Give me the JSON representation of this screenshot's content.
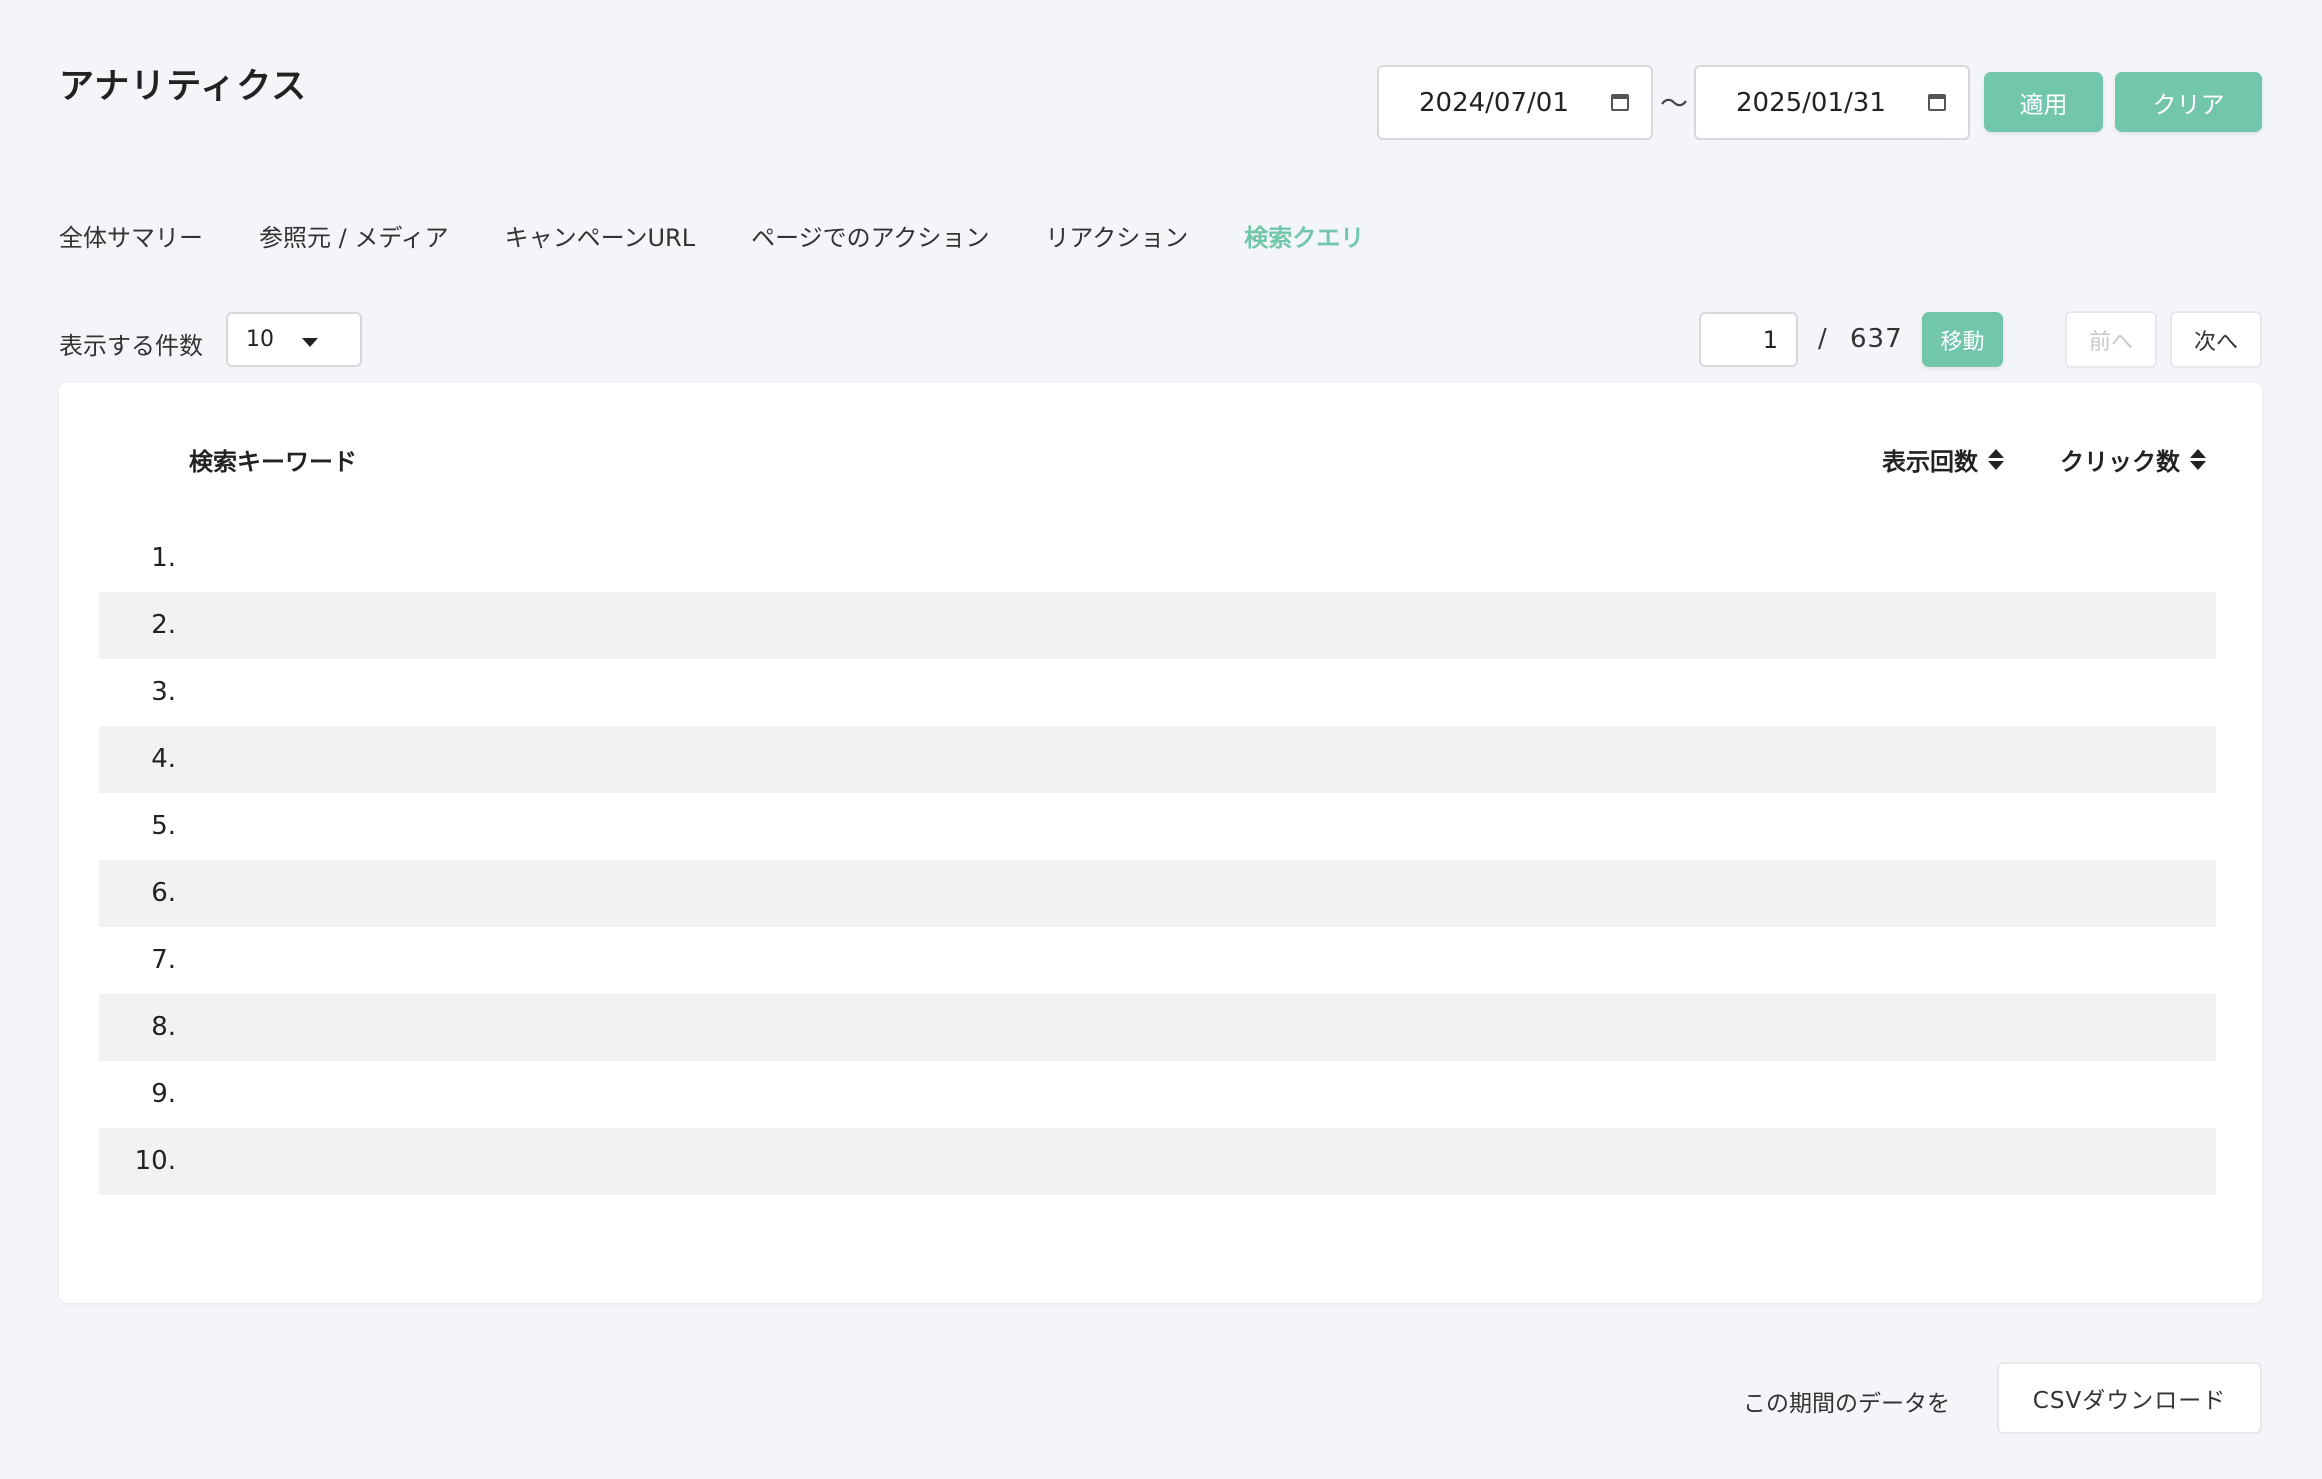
{
  "header": {
    "title": "アナリティクス",
    "date_from": "2024/07/01",
    "date_to": "2025/01/31",
    "tilde": "〜",
    "apply_label": "適用",
    "clear_label": "クリア"
  },
  "tabs": [
    {
      "label": "全体サマリー",
      "active": false
    },
    {
      "label": "参照元 / メディア",
      "active": false
    },
    {
      "label": "キャンペーンURL",
      "active": false
    },
    {
      "label": "ページでのアクション",
      "active": false
    },
    {
      "label": "リアクション",
      "active": false
    },
    {
      "label": "検索クエリ",
      "active": true
    }
  ],
  "controls": {
    "per_page_label": "表示する件数",
    "per_page_value": "10",
    "current_page": "1",
    "page_separator": "/",
    "total_pages": "637",
    "go_label": "移動",
    "prev_label": "前へ",
    "next_label": "次へ"
  },
  "table": {
    "columns": {
      "keyword": "検索キーワード",
      "impressions": "表示回数",
      "clicks": "クリック数"
    },
    "rows": [
      {
        "num": "1.",
        "keyword": "",
        "impressions": "",
        "clicks": ""
      },
      {
        "num": "2.",
        "keyword": "",
        "impressions": "",
        "clicks": ""
      },
      {
        "num": "3.",
        "keyword": "",
        "impressions": "",
        "clicks": ""
      },
      {
        "num": "4.",
        "keyword": "",
        "impressions": "",
        "clicks": ""
      },
      {
        "num": "5.",
        "keyword": "",
        "impressions": "",
        "clicks": ""
      },
      {
        "num": "6.",
        "keyword": "",
        "impressions": "",
        "clicks": ""
      },
      {
        "num": "7.",
        "keyword": "",
        "impressions": "",
        "clicks": ""
      },
      {
        "num": "8.",
        "keyword": "",
        "impressions": "",
        "clicks": ""
      },
      {
        "num": "9.",
        "keyword": "",
        "impressions": "",
        "clicks": ""
      },
      {
        "num": "10.",
        "keyword": "",
        "impressions": "",
        "clicks": ""
      }
    ],
    "more_link": ""
  },
  "footer": {
    "period_text": "この期間のデータを",
    "csv_label": "CSVダウンロード"
  },
  "colors": {
    "accent": "#72c6ab",
    "background": "#f4f5f9",
    "row_shade": "#f2f2f2"
  }
}
